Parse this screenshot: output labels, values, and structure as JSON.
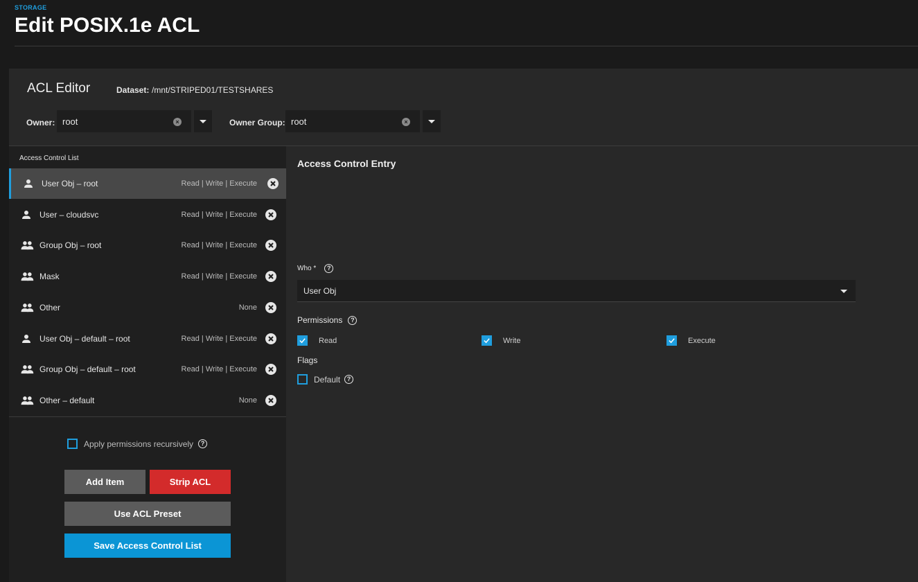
{
  "header": {
    "breadcrumb": "STORAGE",
    "title": "Edit POSIX.1e ACL"
  },
  "editor": {
    "title": "ACL Editor",
    "dataset_label": "Dataset:",
    "dataset_value": "/mnt/STRIPED01/TESTSHARES",
    "owner_label": "Owner:",
    "owner_value": "root",
    "owner_group_label": "Owner Group:",
    "owner_group_value": "root"
  },
  "acl_list": {
    "title": "Access Control List",
    "items": [
      {
        "label": "User Obj – root",
        "perms": "Read | Write | Execute",
        "icon": "person-icon",
        "selected": true
      },
      {
        "label": "User – cloudsvc",
        "perms": "Read | Write | Execute",
        "icon": "person-icon"
      },
      {
        "label": "Group Obj – root",
        "perms": "Read | Write | Execute",
        "icon": "group-icon"
      },
      {
        "label": "Mask",
        "perms": "Read | Write | Execute",
        "icon": "group-icon"
      },
      {
        "label": "Other",
        "perms": "None",
        "icon": "group-icon"
      },
      {
        "label": "User Obj – default – root",
        "perms": "Read | Write | Execute",
        "icon": "person-icon"
      },
      {
        "label": "Group Obj – default – root",
        "perms": "Read | Write | Execute",
        "icon": "group-icon"
      },
      {
        "label": "Other – default",
        "perms": "None",
        "icon": "group-icon"
      }
    ]
  },
  "recursive": {
    "label": "Apply permissions recursively",
    "checked": false
  },
  "buttons": {
    "add_item": "Add Item",
    "strip_acl": "Strip ACL",
    "use_preset": "Use ACL Preset",
    "save": "Save Access Control List"
  },
  "entry": {
    "title": "Access Control Entry",
    "who_label": "Who *",
    "who_value": "User Obj",
    "permissions_label": "Permissions",
    "read_label": "Read",
    "write_label": "Write",
    "execute_label": "Execute",
    "read_checked": true,
    "write_checked": true,
    "execute_checked": true,
    "flags_label": "Flags",
    "default_label": "Default",
    "default_checked": false
  },
  "colors": {
    "accent": "#1f9ede",
    "danger": "#d32b2b",
    "primary_button": "#0b95d5"
  }
}
